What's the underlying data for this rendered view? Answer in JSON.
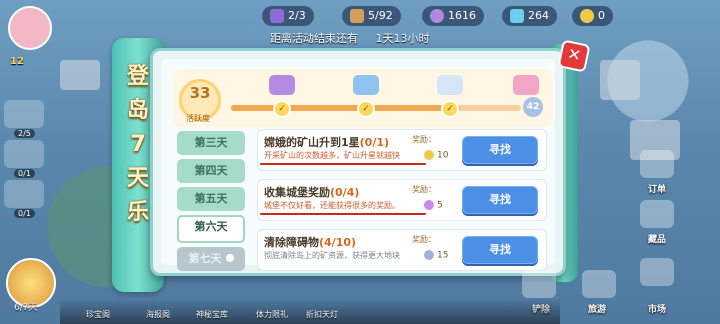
{
  "top": {
    "level": "12",
    "res1": "2/3",
    "res2": "5/92",
    "res3": "1616",
    "res4": "264",
    "res5": "0",
    "timer_label": "距离活动结束还有",
    "timer_value": "1天13小时"
  },
  "scroll": {
    "title": "登岛7天乐"
  },
  "activity": {
    "value": "33",
    "label": "活跃度",
    "max": "42",
    "progress_fraction": 0.79
  },
  "tabs": [
    {
      "label": "第三天",
      "state": "normal"
    },
    {
      "label": "第四天",
      "state": "normal"
    },
    {
      "label": "第五天",
      "state": "normal"
    },
    {
      "label": "第六天",
      "state": "active"
    },
    {
      "label": "第七天",
      "state": "locked"
    }
  ],
  "tasks": [
    {
      "title": "嫦娥的矿山升到1星",
      "count": "(0/1)",
      "desc": "开采矿山的次数越多，矿山升星就越快",
      "reward_label": "奖励：",
      "reward_value": "10",
      "button": "寻找",
      "coin_color": "#f1c84b"
    },
    {
      "title": "收集城堡奖励",
      "count": "(0/4)",
      "desc": "城堡不仅好看，还能获得很多的奖励。",
      "reward_label": "奖励：",
      "reward_value": "5",
      "button": "寻找",
      "coin_color": "#c98ae8"
    },
    {
      "title": "清除障碍物",
      "count": "(4/10)",
      "desc": "彻底清除岛上的矿资源，获得更大地块",
      "reward_label": "奖励：",
      "reward_value": "15",
      "button": "寻找",
      "coin_color": "#9fb4d6"
    }
  ],
  "left_side": {
    "counts": [
      "2/5",
      "0/1",
      "0/1"
    ],
    "day": "6/7天"
  },
  "bottom_bar": [
    "珍宝阁",
    "海报阁",
    "神秘宝库",
    "体力限礼",
    "折扣天灯"
  ],
  "right_side": {
    "order": "订单",
    "collection": "藏品",
    "market": "市场",
    "shovel": "铲除",
    "tour": "旅游"
  },
  "colors": {
    "accent": "#4b8fe6",
    "panel_border": "#8fd0cf",
    "scroll": "#4cc0b3"
  }
}
